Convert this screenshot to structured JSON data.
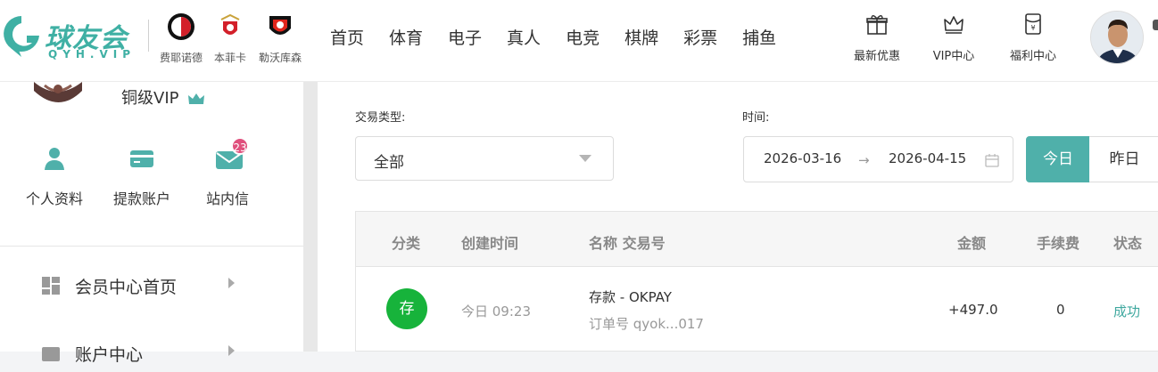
{
  "brand": {
    "name": "球友会",
    "sub": "QYH.VIP"
  },
  "clubs": [
    {
      "name": "费耶诺德",
      "icon": "feyenoord-badge-icon"
    },
    {
      "name": "本菲卡",
      "icon": "benfica-badge-icon"
    },
    {
      "name": "勒沃库森",
      "icon": "leverkusen-badge-icon"
    }
  ],
  "nav": [
    "首页",
    "体育",
    "电子",
    "真人",
    "电竞",
    "棋牌",
    "彩票",
    "捕鱼"
  ],
  "promos": [
    {
      "label": "最新优惠",
      "icon": "gift-icon"
    },
    {
      "label": "VIP中心",
      "icon": "crown-icon"
    },
    {
      "label": "福利中心",
      "icon": "red-envelope-icon"
    }
  ],
  "user": {
    "level": "铜级VIP"
  },
  "quick_links": [
    {
      "label": "个人资料",
      "icon": "user-icon"
    },
    {
      "label": "提款账户",
      "icon": "card-icon"
    },
    {
      "label": "站内信",
      "icon": "mail-icon",
      "badge": "23"
    }
  ],
  "menu": [
    {
      "label": "会员中心首页",
      "icon": "dashboard-icon"
    },
    {
      "label": "账户中心",
      "icon": "wallet-icon"
    }
  ],
  "filters": {
    "type_label": "交易类型:",
    "type_value": "全部",
    "time_label": "时间:",
    "date_from": "2026-03-16",
    "date_sep": "→",
    "date_to": "2026-04-15",
    "today": "今日",
    "yesterday": "昨日"
  },
  "table": {
    "headers": [
      "分类",
      "创建时间",
      "名称 交易号",
      "金额",
      "手续费",
      "状态"
    ],
    "rows": [
      {
        "category": "存",
        "created": "今日 09:23",
        "name": "存款 - OKPAY",
        "order": "订单号 qyok...017",
        "amount": "+497.0",
        "fee": "0",
        "status": "成功"
      }
    ]
  },
  "colors": {
    "accent": "#4fb0aa",
    "deposit_badge": "#17b33b",
    "status_success": "#3fa89f",
    "msg_badge": "#e0507d"
  }
}
